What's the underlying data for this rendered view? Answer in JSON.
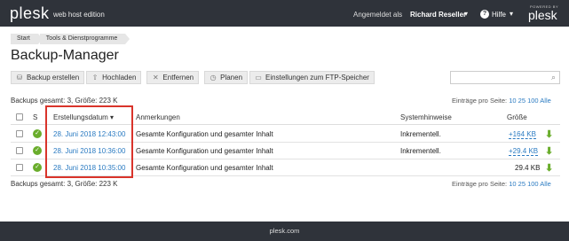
{
  "header": {
    "logo": "plesk",
    "edition": "web host edition",
    "login_label": "Angemeldet als",
    "user_name": "Richard Reseller",
    "help_label": "Hilfe",
    "powered_by": "POWERED BY",
    "powered_logo": "plesk"
  },
  "breadcrumb": [
    "Start",
    "Tools & Dienstprogramme"
  ],
  "page_title": "Backup-Manager",
  "toolbar": {
    "backup": "Backup erstellen",
    "upload": "Hochladen",
    "remove": "Entfernen",
    "schedule": "Planen",
    "ftp_settings": "Einstellungen zum FTP-Speicher"
  },
  "summary": "Backups gesamt: 3, Größe: 223 K",
  "per_page": {
    "label": "Einträge pro Seite:",
    "options": [
      "10",
      "25",
      "100",
      "Alle"
    ]
  },
  "table": {
    "headers": {
      "status": "S",
      "date": "Erstellungsdatum",
      "comments": "Anmerkungen",
      "system_notes": "Systemhinweise",
      "size": "Größe"
    },
    "rows": [
      {
        "date": "28. Juni 2018 12:43:00",
        "comment": "Gesamte Konfiguration und gesamter Inhalt",
        "note": "Inkrementell.",
        "size": "+164 KB"
      },
      {
        "date": "28. Juni 2018 10:36:00",
        "comment": "Gesamte Konfiguration und gesamter Inhalt",
        "note": "Inkrementell.",
        "size": "+29.4 KB"
      },
      {
        "date": "28. Juni 2018 10:35:00",
        "comment": "Gesamte Konfiguration und gesamter Inhalt",
        "note": "",
        "size": "29.4 KB"
      }
    ]
  },
  "footer": "plesk.com",
  "colors": {
    "topbar": "#2f333a",
    "link": "#2b7bc2",
    "ok_green": "#6aad2c",
    "highlight_red": "#d9342b"
  }
}
